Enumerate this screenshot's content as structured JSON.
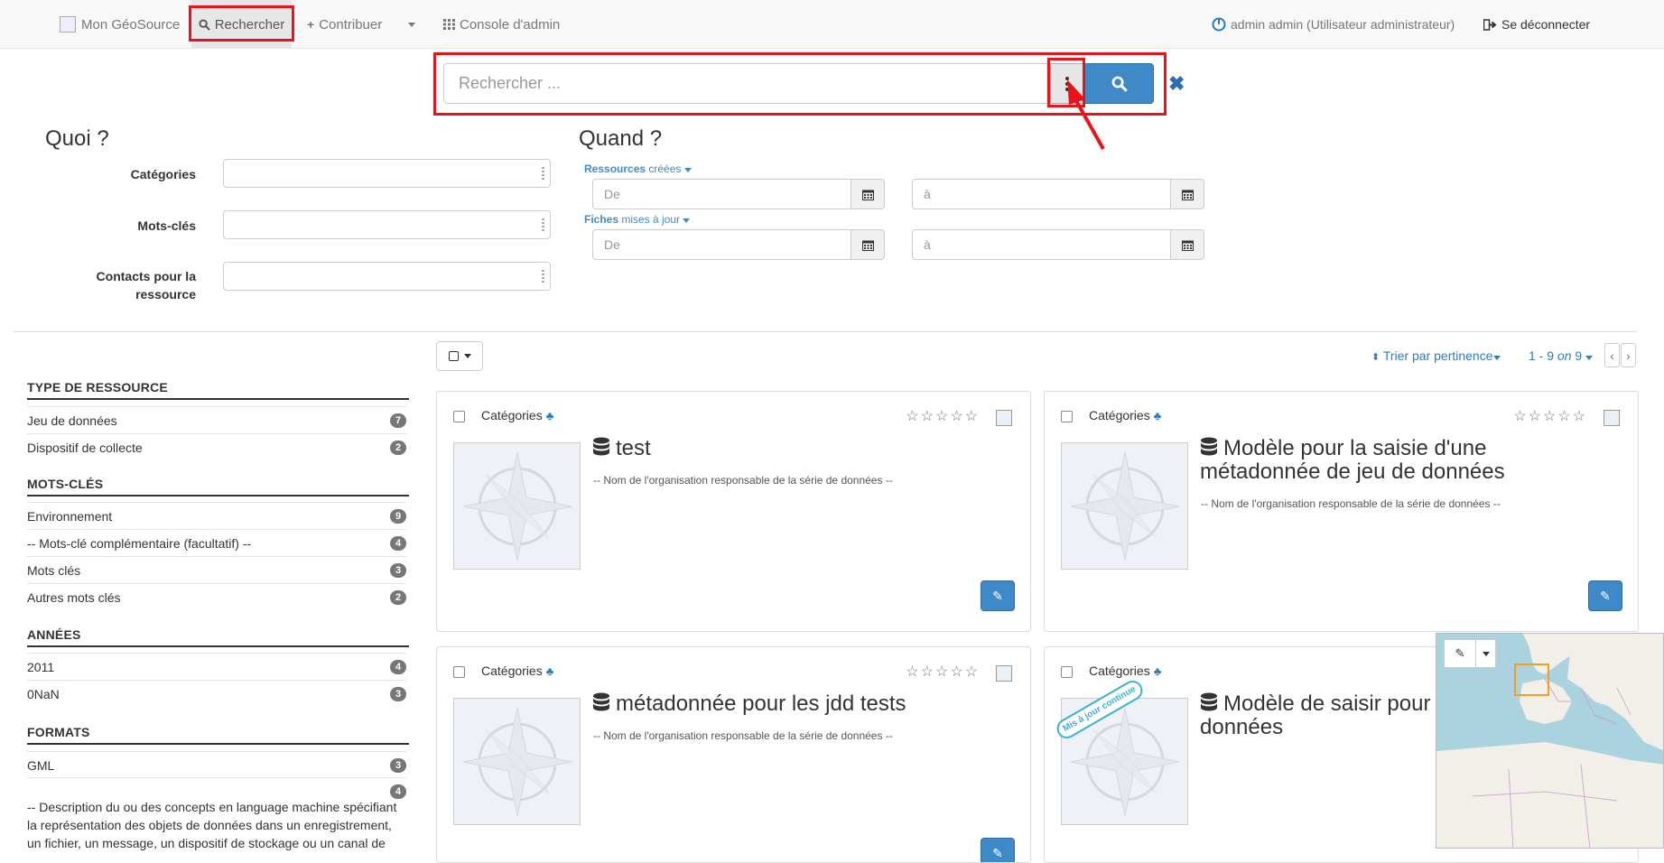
{
  "nav": {
    "brand": "Mon GéoSource",
    "search": "Rechercher",
    "contribute": "Contribuer",
    "admin_console": "Console d'admin",
    "user": "admin admin (Utilisateur administrateur)",
    "logout": "Se déconnecter"
  },
  "search": {
    "placeholder": "Rechercher ..."
  },
  "what": {
    "heading": "Quoi ?",
    "categories_label": "Catégories",
    "keywords_label": "Mots-clés",
    "contacts_label_line1": "Contacts pour la",
    "contacts_label_line2": "ressource"
  },
  "when": {
    "heading": "Quand ?",
    "created_label_bold": "Ressources",
    "created_label_rest": " créées",
    "updated_label_bold": "Fiches",
    "updated_label_rest": " mises à jour",
    "from_placeholder": "De",
    "to_placeholder": "à"
  },
  "toolbar": {
    "sort": "Trier par pertinence",
    "range_start": "1 - 9",
    "range_on": "on",
    "range_total": "9"
  },
  "facets": [
    {
      "heading": "TYPE DE RESSOURCE",
      "items": [
        {
          "label": "Jeu de données",
          "count": "7"
        },
        {
          "label": "Dispositif de collecte",
          "count": "2"
        }
      ]
    },
    {
      "heading": "MOTS-CLÉS",
      "items": [
        {
          "label": "Environnement",
          "count": "9"
        },
        {
          "label": "-- Mots-clé complémentaire (facultatif) --",
          "count": "4"
        },
        {
          "label": "Mots clés",
          "count": "3"
        },
        {
          "label": "Autres mots clés",
          "count": "2"
        }
      ]
    },
    {
      "heading": "ANNÉES",
      "items": [
        {
          "label": "2011",
          "count": "4"
        },
        {
          "label": "0NaN",
          "count": "3"
        }
      ]
    },
    {
      "heading": "FORMATS",
      "items": [
        {
          "label": "GML",
          "count": "3"
        },
        {
          "label": "",
          "count": "4"
        }
      ]
    }
  ],
  "formats_desc": "-- Description du ou des concepts en language machine spécifiant la représentation des objets de données dans un enregistrement, un fichier, un message, un dispositif de stockage ou un canal de",
  "cards": [
    {
      "category": "Catégories",
      "title": "test",
      "org": "-- Nom de l'organisation responsable de la série de données --"
    },
    {
      "category": "Catégories",
      "title": "Modèle pour la saisie d'une métadonnée de jeu de données",
      "org": "-- Nom de l'organisation responsable de la série de données --"
    },
    {
      "category": "Catégories",
      "title": "métadonnée pour les jdd tests",
      "org": "-- Nom de l'organisation responsable de la série de données --"
    },
    {
      "category": "Catégories",
      "title": "Modèle de saisir pour données",
      "ribbon": "Mis à jour continue"
    }
  ],
  "colors": {
    "primary": "#3f89c9",
    "highlight": "#e8131b",
    "link": "#337ab7",
    "ribbon": "#3ab0d8"
  }
}
